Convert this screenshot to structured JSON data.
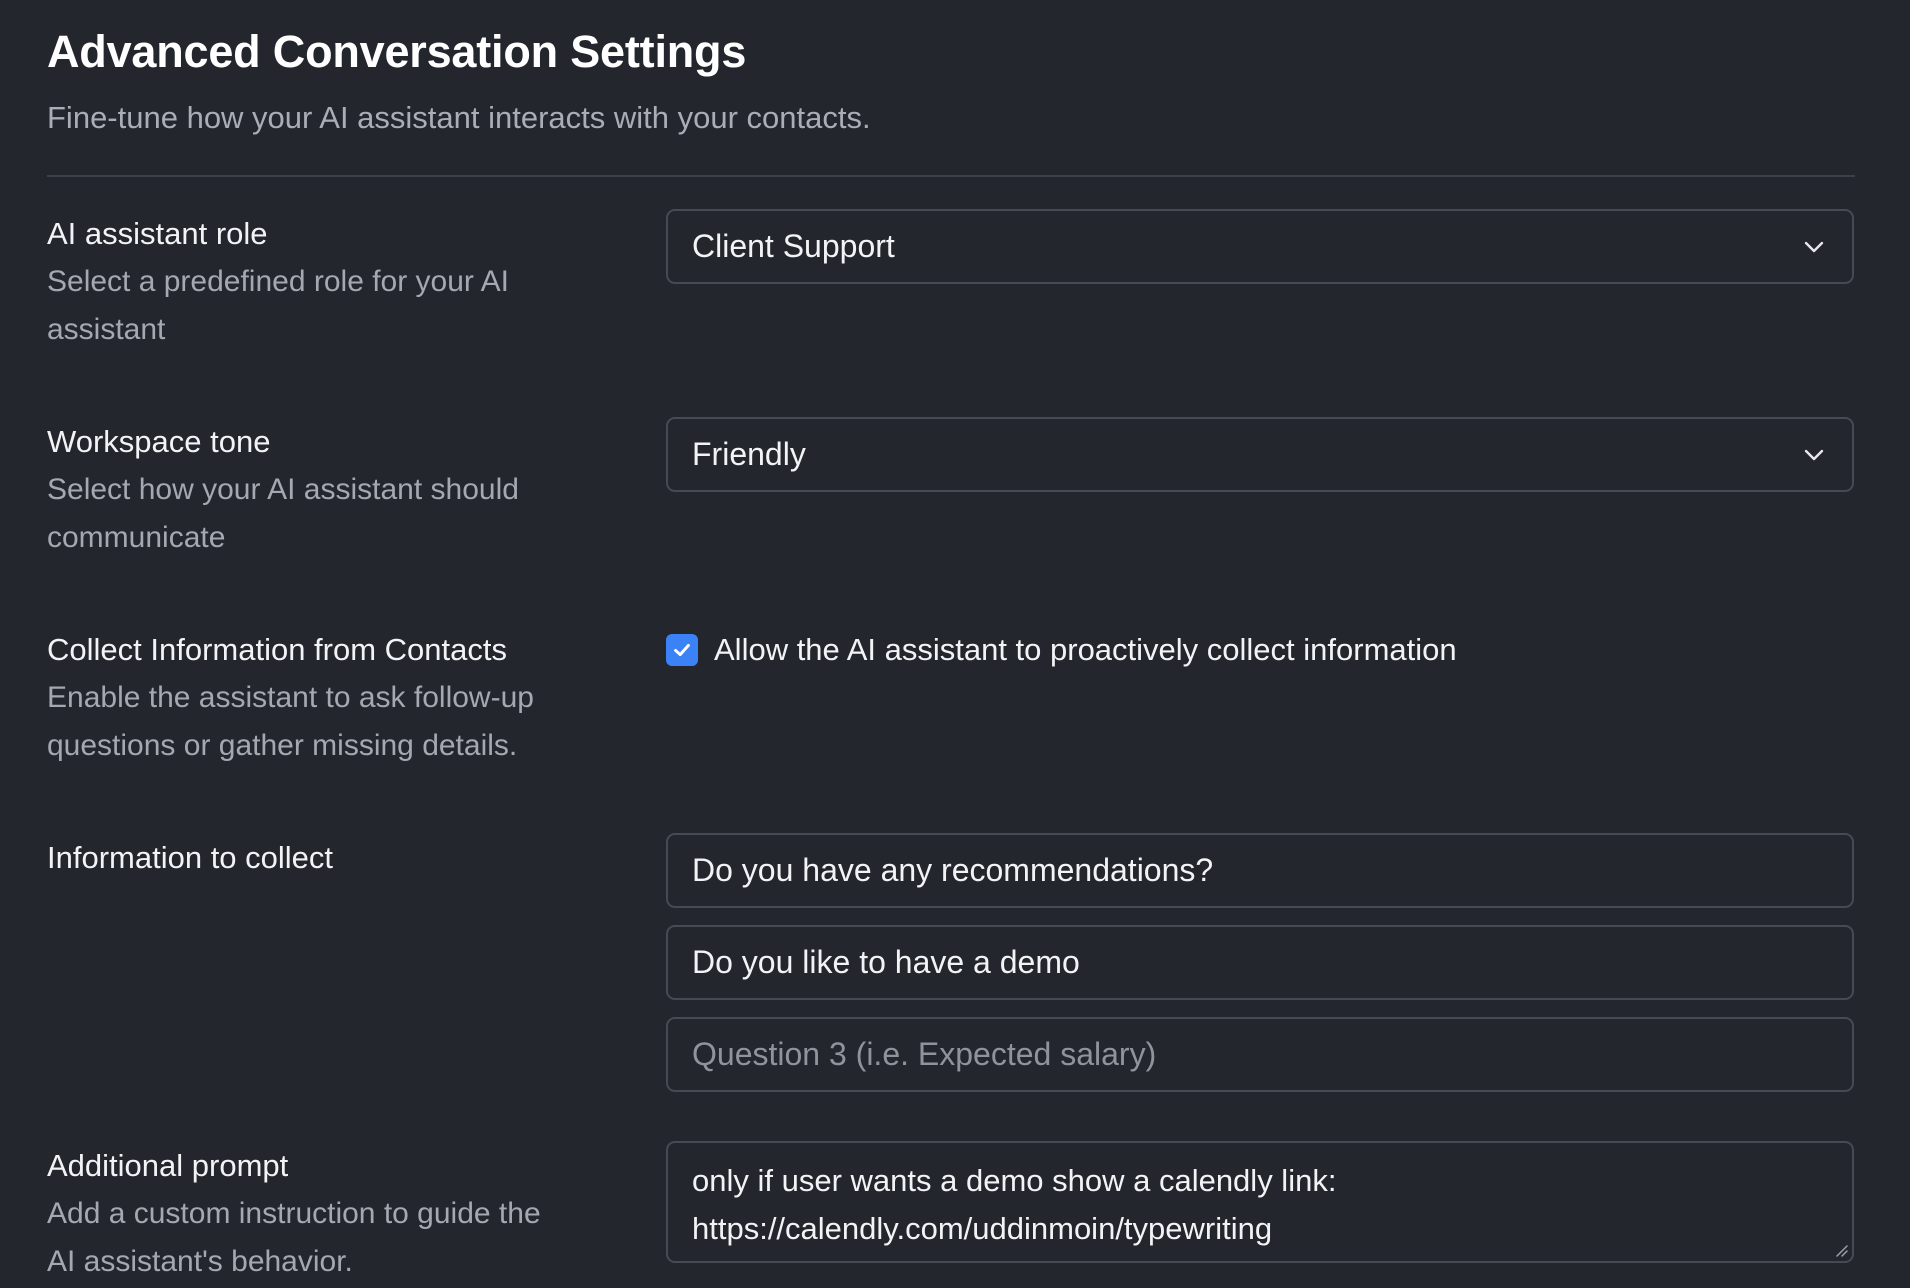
{
  "header": {
    "title": "Advanced Conversation Settings",
    "subtitle": "Fine-tune how your AI assistant interacts with your contacts."
  },
  "role": {
    "label": "AI assistant role",
    "description_line1": "Select a predefined role for your AI",
    "description_line2": "assistant",
    "selected": "Client Support",
    "icon": "chevron-down-icon"
  },
  "tone": {
    "label": "Workspace tone",
    "description_line1": "Select how your AI assistant should",
    "description_line2": "communicate",
    "selected": "Friendly",
    "icon": "chevron-down-icon"
  },
  "collect": {
    "label": "Collect Information from Contacts",
    "description_line1": "Enable the assistant to ask follow-up",
    "description_line2": "questions or gather missing details.",
    "checkbox_label": "Allow the AI assistant to proactively collect information",
    "checked": true,
    "accent_color": "#3b82f6"
  },
  "info": {
    "label": "Information to collect",
    "question1_value": "Do you have any recommendations?",
    "question2_value": "Do you like to have a demo",
    "question3_placeholder": "Question 3 (i.e. Expected salary)"
  },
  "prompt": {
    "label": "Additional prompt",
    "description_line1": "Add a custom instruction to guide the",
    "description_line2": "AI assistant's behavior.",
    "value_line1": "only if user wants a demo show a calendly link:",
    "value_line2": "https://calendly.com/uddinmoin/typewriting"
  }
}
